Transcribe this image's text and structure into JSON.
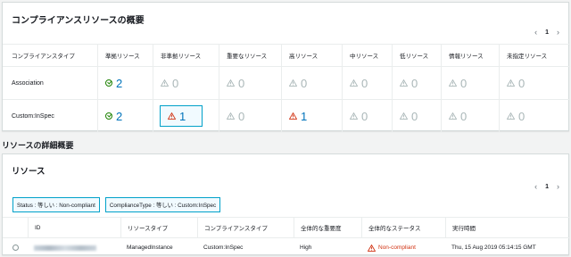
{
  "summary": {
    "title": "コンプライアンスリソースの概要",
    "page": "1",
    "columns": [
      "コンプライアンスタイプ",
      "準拠リソース",
      "非準拠リソース",
      "重要なリソース",
      "高リソース",
      "中リソース",
      "低リソース",
      "情報リソース",
      "未指定リソース"
    ],
    "rows": [
      {
        "label": "Association",
        "compliant": "2",
        "noncompliant": "0",
        "critical": "0",
        "high": "0",
        "medium": "0",
        "low": "0",
        "info": "0",
        "unspecified": "0"
      },
      {
        "label": "Custom:InSpec",
        "compliant": "2",
        "noncompliant": "1",
        "critical": "0",
        "high": "1",
        "medium": "0",
        "low": "0",
        "info": "0",
        "unspecified": "0"
      }
    ]
  },
  "detail_heading": "リソースの詳細概要",
  "resources": {
    "title": "リソース",
    "page": "1",
    "filters": [
      "Status : 等しい : Non-compliant",
      "ComplianceType : 等しい : Custom:InSpec"
    ],
    "columns": [
      "ID",
      "リソースタイプ",
      "コンプライアンスタイプ",
      "全体的な重要度",
      "全体的なステータス",
      "実行時間"
    ],
    "rows": [
      {
        "resource_type": "ManagedInstance",
        "compliance_type": "Custom:InSpec",
        "severity": "High",
        "status": "Non-compliant",
        "executed": "Thu, 15 Aug 2019 05:14:15 GMT"
      }
    ]
  },
  "colors": {
    "ok": "#1d8102",
    "alert": "#d13212",
    "link": "#0073bb",
    "muted": "#aab7b8",
    "focus": "#00a1c9"
  }
}
